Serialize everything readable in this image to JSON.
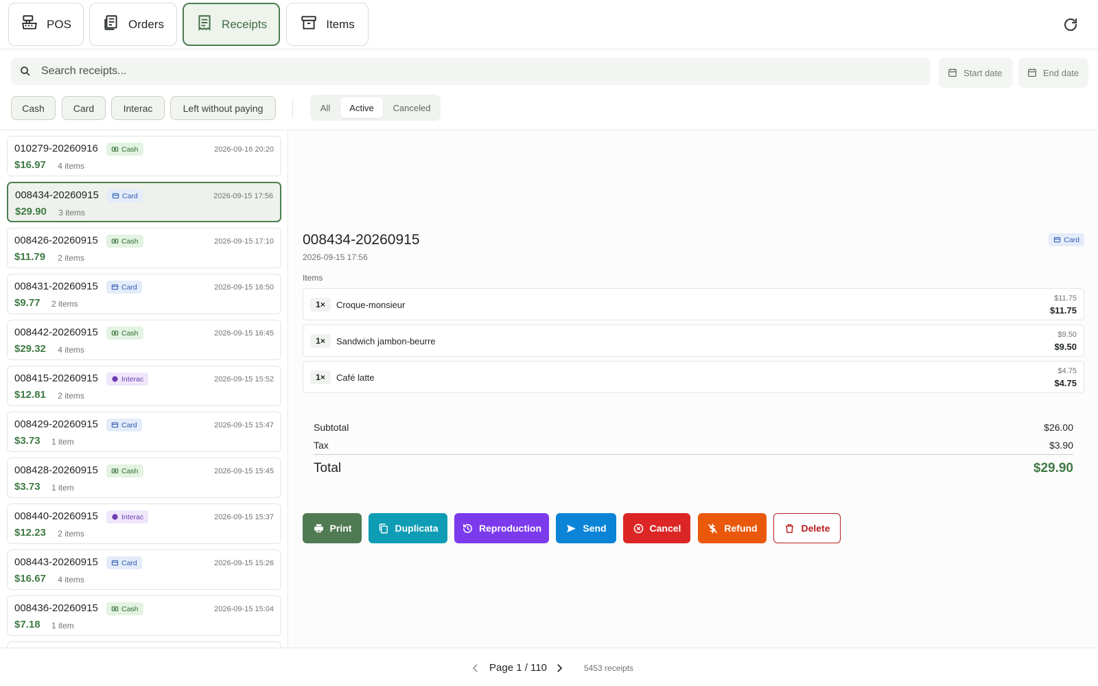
{
  "nav": {
    "tabs": [
      {
        "label": "POS",
        "icon": "cash-register-icon"
      },
      {
        "label": "Orders",
        "icon": "orders-icon"
      },
      {
        "label": "Receipts",
        "icon": "receipt-icon",
        "active": true
      },
      {
        "label": "Items",
        "icon": "archive-box-icon"
      }
    ],
    "refresh_icon": "refresh-icon"
  },
  "search": {
    "placeholder": "Search receipts..."
  },
  "dates": {
    "start": "Start date",
    "end": "End date"
  },
  "payment_filters": [
    "Cash",
    "Card",
    "Interac",
    "Left without paying"
  ],
  "status_filter": {
    "options": [
      "All",
      "Active",
      "Canceled"
    ],
    "selected": "Active"
  },
  "receipts": [
    {
      "id": "010279-20260916",
      "method": "Cash",
      "date": "2026-09-16 20:20",
      "amount": "$16.97",
      "items": "4 items"
    },
    {
      "id": "008434-20260915",
      "method": "Card",
      "date": "2026-09-15 17:56",
      "amount": "$29.90",
      "items": "3 items",
      "selected": true
    },
    {
      "id": "008426-20260915",
      "method": "Cash",
      "date": "2026-09-15 17:10",
      "amount": "$11.79",
      "items": "2 items"
    },
    {
      "id": "008431-20260915",
      "method": "Card",
      "date": "2026-09-15 16:50",
      "amount": "$9.77",
      "items": "2 items"
    },
    {
      "id": "008442-20260915",
      "method": "Cash",
      "date": "2026-09-15 16:45",
      "amount": "$29.32",
      "items": "4 items"
    },
    {
      "id": "008415-20260915",
      "method": "Interac",
      "date": "2026-09-15 15:52",
      "amount": "$12.81",
      "items": "2 items"
    },
    {
      "id": "008429-20260915",
      "method": "Card",
      "date": "2026-09-15 15:47",
      "amount": "$3.73",
      "items": "1 item"
    },
    {
      "id": "008428-20260915",
      "method": "Cash",
      "date": "2026-09-15 15:45",
      "amount": "$3.73",
      "items": "1 item"
    },
    {
      "id": "008440-20260915",
      "method": "Interac",
      "date": "2026-09-15 15:37",
      "amount": "$12.23",
      "items": "2 items"
    },
    {
      "id": "008443-20260915",
      "method": "Card",
      "date": "2026-09-15 15:26",
      "amount": "$16.67",
      "items": "4 items"
    },
    {
      "id": "008436-20260915",
      "method": "Cash",
      "date": "2026-09-15 15:04",
      "amount": "$7.18",
      "items": "1 item"
    }
  ],
  "detail": {
    "id": "008434-20260915",
    "date": "2026-09-15 17:56",
    "method": "Card",
    "items_label": "Items",
    "lines": [
      {
        "qty": "1×",
        "name": "Croque-monsieur",
        "unit": "$11.75",
        "total": "$11.75"
      },
      {
        "qty": "1×",
        "name": "Sandwich jambon-beurre",
        "unit": "$9.50",
        "total": "$9.50"
      },
      {
        "qty": "1×",
        "name": "Café latte",
        "unit": "$4.75",
        "total": "$4.75"
      }
    ],
    "subtotal_label": "Subtotal",
    "subtotal": "$26.00",
    "tax_label": "Tax",
    "tax": "$3.90",
    "total_label": "Total",
    "total": "$29.90"
  },
  "actions": [
    {
      "label": "Print",
      "icon": "printer-icon",
      "color": "#4f7a52"
    },
    {
      "label": "Duplicata",
      "icon": "copy-icon",
      "color": "#0e9db5"
    },
    {
      "label": "Reproduction",
      "icon": "history-icon",
      "color": "#7c3aed"
    },
    {
      "label": "Send",
      "icon": "send-icon",
      "color": "#0b84d8"
    },
    {
      "label": "Cancel",
      "icon": "cancel-circle-icon",
      "color": "#dc2626"
    },
    {
      "label": "Refund",
      "icon": "refund-dollar-icon",
      "color": "#ea580c"
    },
    {
      "label": "Delete",
      "icon": "trash-icon",
      "color": "#b91c1c"
    }
  ],
  "pagination": {
    "label": "Page 1 / 110",
    "count": "5453 receipts"
  },
  "colors": {
    "accent": "#4a7c4e",
    "amount": "#3f7a45"
  }
}
